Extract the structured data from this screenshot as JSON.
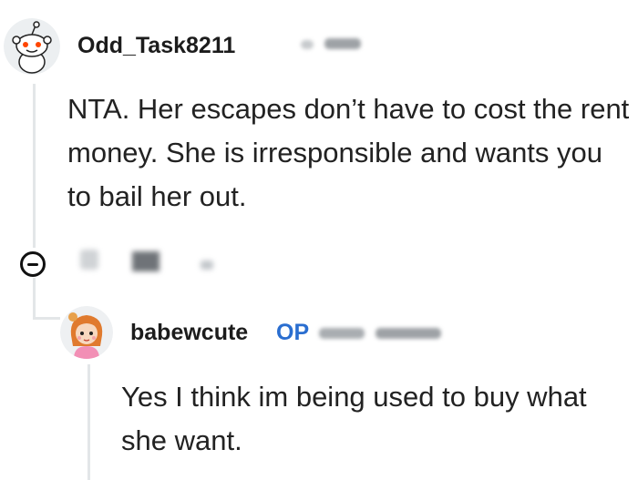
{
  "comments": [
    {
      "username": "Odd_Task8211",
      "avatar": "snoo-avatar-icon",
      "body": "NTA. Her escapes don’t have to cost the rent money. She is irresponsible and wants you to bail her out."
    },
    {
      "username": "babewcute",
      "op_label": "OP",
      "avatar": "girl-avatar-icon",
      "body": "Yes I think im being used to buy what she want."
    }
  ],
  "icons": {
    "collapse": "collapse-minus-icon"
  },
  "colors": {
    "op": "#2a6ed0",
    "thread_line": "#e3e6e8"
  }
}
